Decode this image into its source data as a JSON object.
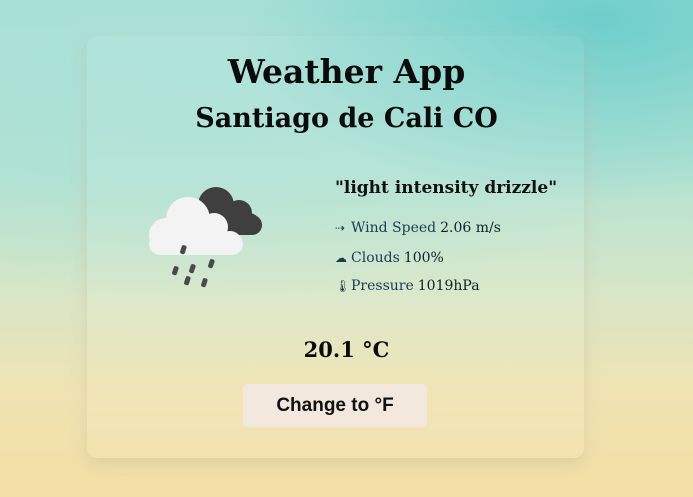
{
  "app": {
    "title": "Weather App",
    "city": "Santiago de Cali CO"
  },
  "weather": {
    "icon": "cloud-rain-icon",
    "description": "\"light intensity drizzle\"",
    "temperature": "20.1 °C"
  },
  "details": {
    "wind": {
      "icon": "arrow-right-icon",
      "glyph": "⇢",
      "label": "Wind Speed",
      "value": "2.06 m/s"
    },
    "clouds": {
      "icon": "cloud-icon",
      "glyph": "☁",
      "label": "Clouds",
      "value": "100%"
    },
    "pressure": {
      "icon": "thermometer-icon",
      "glyph": "🌡",
      "label": "Pressure",
      "value": "1019hPa"
    }
  },
  "actions": {
    "toggle_unit_label": "Change to °F"
  },
  "colors": {
    "dark_cloud": "#3f3f3f",
    "light_cloud": "#f2f2f2",
    "rain_drop": "#4a4a4a",
    "button_bg": "#f3e8de"
  }
}
